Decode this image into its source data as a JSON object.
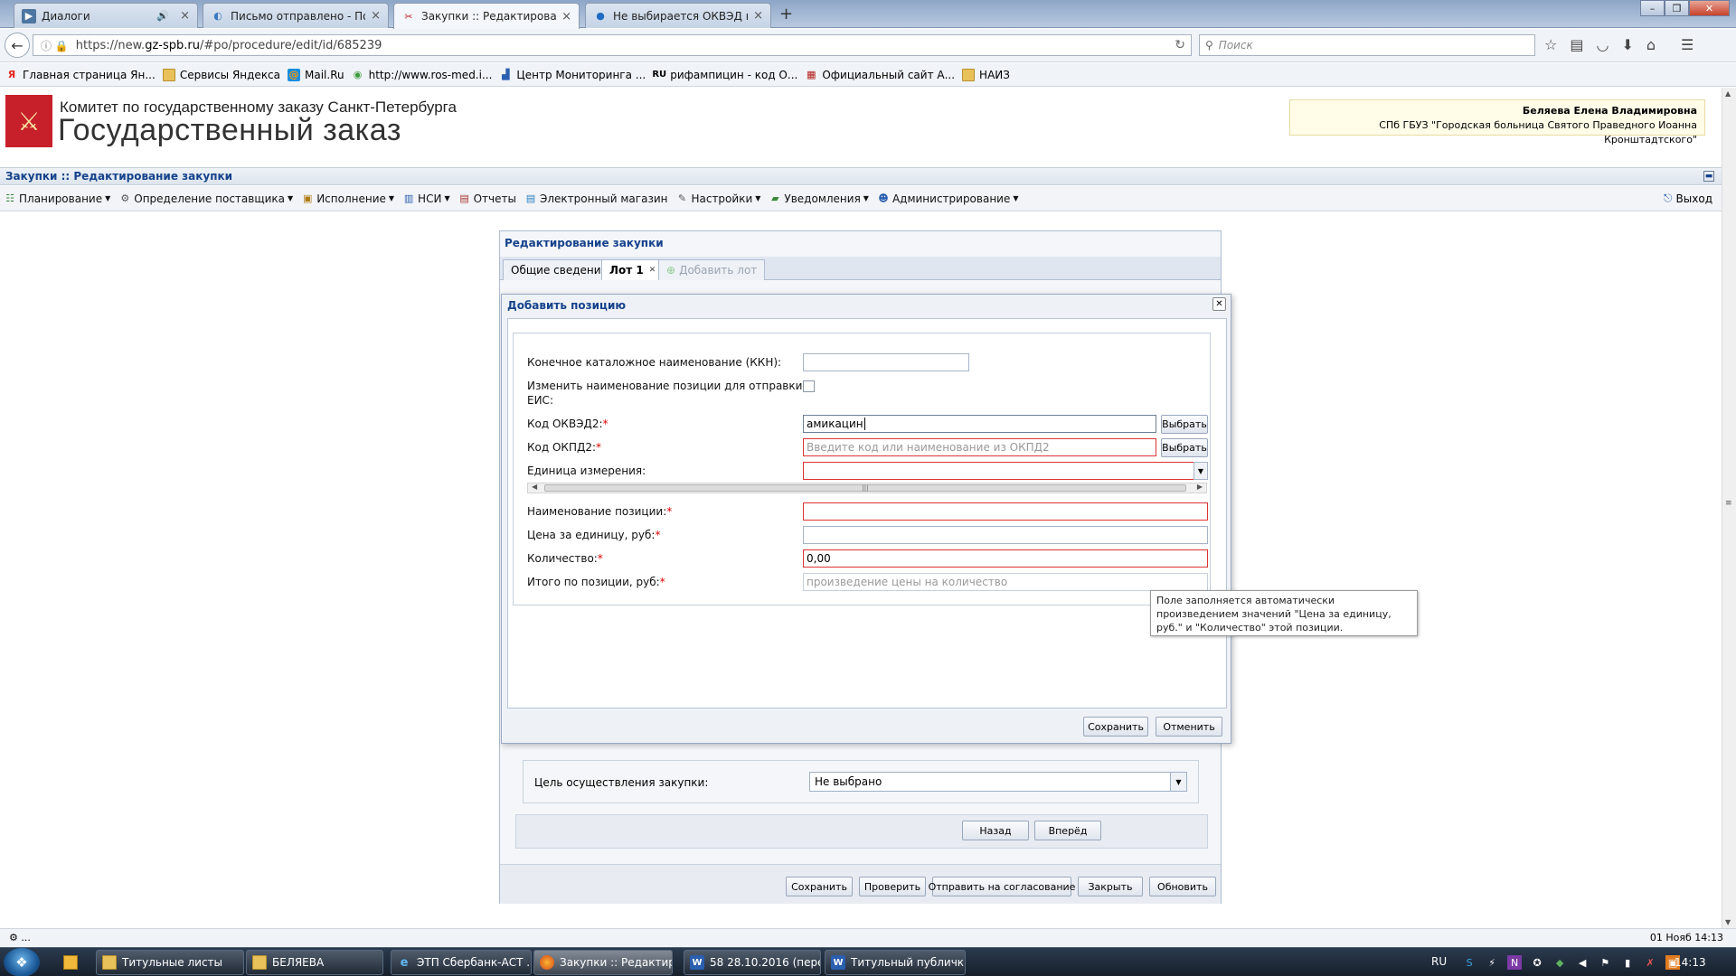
{
  "browser": {
    "tabs": [
      {
        "title": "Диалоги",
        "icon": "vk-icon"
      },
      {
        "title": "Письмо отправлено - По...",
        "icon": "loading-icon"
      },
      {
        "title": "Закупки :: Редактировани...",
        "icon": "gz-icon",
        "active": true
      },
      {
        "title": "Не выбирается ОКВЭД на ...",
        "icon": "globe-icon"
      }
    ],
    "url_prefix": "https://new.",
    "url_host": "gz-spb.ru",
    "url_path": "/#po/procedure/edit/id/685239",
    "search_placeholder": "Поиск",
    "bookmarks": [
      {
        "label": "Главная страница Ян...",
        "icon": "yandex-icon"
      },
      {
        "label": "Сервисы Яндекса",
        "icon": "folder-icon"
      },
      {
        "label": "Mail.Ru",
        "icon": "mailru-icon"
      },
      {
        "label": "http://www.ros-med.i...",
        "icon": "globe-icon"
      },
      {
        "label": "Центр Мониторинга ...",
        "icon": "chart-icon"
      },
      {
        "label": "рифампицин - код О...",
        "icon": "ru-icon"
      },
      {
        "label": "Официальный сайт А...",
        "icon": "site-icon"
      },
      {
        "label": "НАИЗ",
        "icon": "folder-icon"
      }
    ]
  },
  "header": {
    "org": "Комитет по государственному заказу Санкт-Петербурга",
    "app_name": "Государственный заказ",
    "user_name": "Беляева Елена Владимировна",
    "user_org": "СПб ГБУЗ \"Городская больница Святого Праведного Иоанна Кронштадтского\""
  },
  "page_title": "Закупки :: Редактирование закупки",
  "menu": {
    "items": [
      {
        "label": "Планирование",
        "dropdown": true
      },
      {
        "label": "Определение поставщика",
        "dropdown": true
      },
      {
        "label": "Исполнение",
        "dropdown": true
      },
      {
        "label": "НСИ",
        "dropdown": true
      },
      {
        "label": "Отчеты",
        "dropdown": false
      },
      {
        "label": "Электронный магазин",
        "dropdown": false
      },
      {
        "label": "Настройки",
        "dropdown": true
      },
      {
        "label": "Уведомления",
        "dropdown": true
      },
      {
        "label": "Администрирование",
        "dropdown": true
      }
    ],
    "exit": "Выход"
  },
  "panel": {
    "title": "Редактирование закупки",
    "tabs": {
      "general": "Общие сведения",
      "lot1": "Лот 1",
      "add_lot": "Добавить лот"
    },
    "purpose_label": "Цель осуществления закупки:",
    "purpose_value": "Не выбрано",
    "back": "Назад",
    "forward": "Вперёд",
    "toolbar": {
      "save": "Сохранить",
      "check": "Проверить",
      "send": "Отправить на согласование",
      "close": "Закрыть",
      "refresh": "Обновить"
    }
  },
  "modal": {
    "title": "Добавить позицию",
    "fields": {
      "kkn_label": "Конечное каталожное наименование (ККН):",
      "kkn_value": "",
      "rename_label_1": "Изменить наименование позиции для отправки в",
      "rename_label_2": "ЕИС:",
      "okved_label": "Код ОКВЭД2:",
      "okved_value": "амикацин",
      "okpd_label": "Код ОКПД2:",
      "okpd_placeholder": "Введите код или наименование из ОКПД2",
      "unit_label": "Единица измерения:",
      "unit_value": "",
      "name_label": "Наименование позиции:",
      "name_value": "",
      "price_label": "Цена за единицу, руб:",
      "price_value": "",
      "qty_label": "Количество:",
      "qty_value": "0,00",
      "total_label": "Итого по позиции, руб:",
      "total_placeholder": "произведение цены на количество",
      "required_mark": "*",
      "choose": "Выбрать"
    },
    "save": "Сохранить",
    "cancel": "Отменить",
    "tooltip": "Поле заполняется автоматически произведением значений \"Цена за единицу, руб.\" и \"Количество\" этой позиции."
  },
  "statusbar": {
    "left": "...",
    "right": "01 Нояб 14:13"
  },
  "taskbar": {
    "tasks": [
      {
        "label": "Титульные листы",
        "icon": "folder-icon"
      },
      {
        "label": "БЕЛЯЕВА",
        "icon": "folder-icon"
      },
      {
        "label": "ЭТП Сбербанк-АСТ ...",
        "icon": "ie-icon"
      },
      {
        "label": "Закупки :: Редактир...",
        "icon": "firefox-icon",
        "active": true
      },
      {
        "label": "58 28.10.2016 (перед...",
        "icon": "word-icon"
      },
      {
        "label": "Титульный публичк...",
        "icon": "word-icon"
      }
    ],
    "lang": "RU",
    "time": "14:13"
  },
  "colors": {
    "accent": "#15428b",
    "invalid": "#dd3333",
    "required": "#dd0000"
  }
}
